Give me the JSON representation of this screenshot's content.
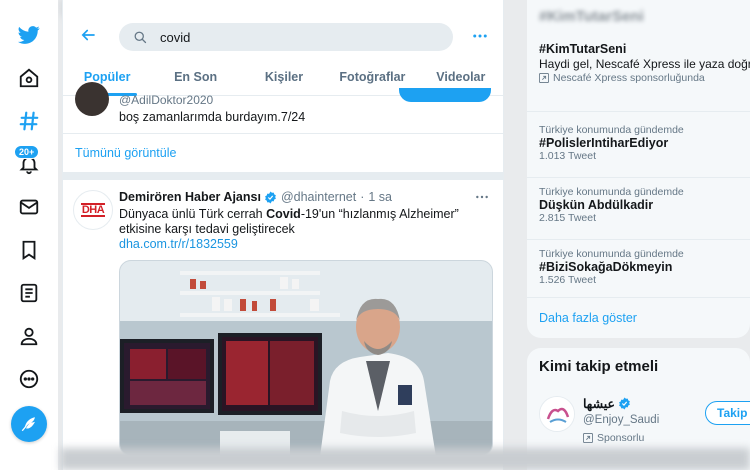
{
  "search": {
    "query": "covid"
  },
  "tabs": [
    {
      "label": "Popüler",
      "active": true
    },
    {
      "label": "En Son"
    },
    {
      "label": "Kişiler"
    },
    {
      "label": "Fotoğraflar"
    },
    {
      "label": "Videolar"
    }
  ],
  "nav": {
    "notifications_badge": "20+"
  },
  "prev_tweet": {
    "handle": "@AdilDoktor2020",
    "text": "boş zamanlarımda burdayım.7/24"
  },
  "show_all_label": "Tümünü görüntüle",
  "tweet": {
    "avatar_text": "DHA",
    "name": "Demirören Haber Ajansı",
    "handle": "@dhainternet",
    "separator": "·",
    "time": "1 sa",
    "text_before": "Dünyaca ünlü Türk cerrah ",
    "text_bold": "Covid",
    "text_after": "-19'un “hızlanmış Alzheimer” etkisine karşı tedavi geliştirecek",
    "link": "dha.com.tr/r/1832559"
  },
  "trends": [
    {
      "name": "#KimTutarSeni",
      "description": "Haydi gel, Nescafé Xpress ile yaza doğru yola çıkalım. Kim tutar seni!",
      "promoted": "Nescafé Xpress sponsorluğunda"
    },
    {
      "context": "Türkiye konumunda gündemde",
      "name": "#PolislerIntiharEdiyor",
      "count": "1.013 Tweet"
    },
    {
      "context": "Türkiye konumunda gündemde",
      "name": "Düşkün Abdülkadir",
      "count": "2.815 Tweet"
    },
    {
      "context": "Türkiye konumunda gündemde",
      "name": "#BiziSokağaDökmeyin",
      "count": "1.526 Tweet"
    }
  ],
  "show_more_label": "Daha fazla göster",
  "who_to_follow": {
    "title": "Kimi takip etmeli",
    "name": "عيشها",
    "handle": "@Enjoy_Saudi",
    "promoted": "Sponsorlu",
    "follow_label": "Takip et"
  },
  "colors": {
    "accent": "#1da1f2",
    "text": "#14171a",
    "muted": "#657786",
    "dha_red": "#d32027"
  }
}
